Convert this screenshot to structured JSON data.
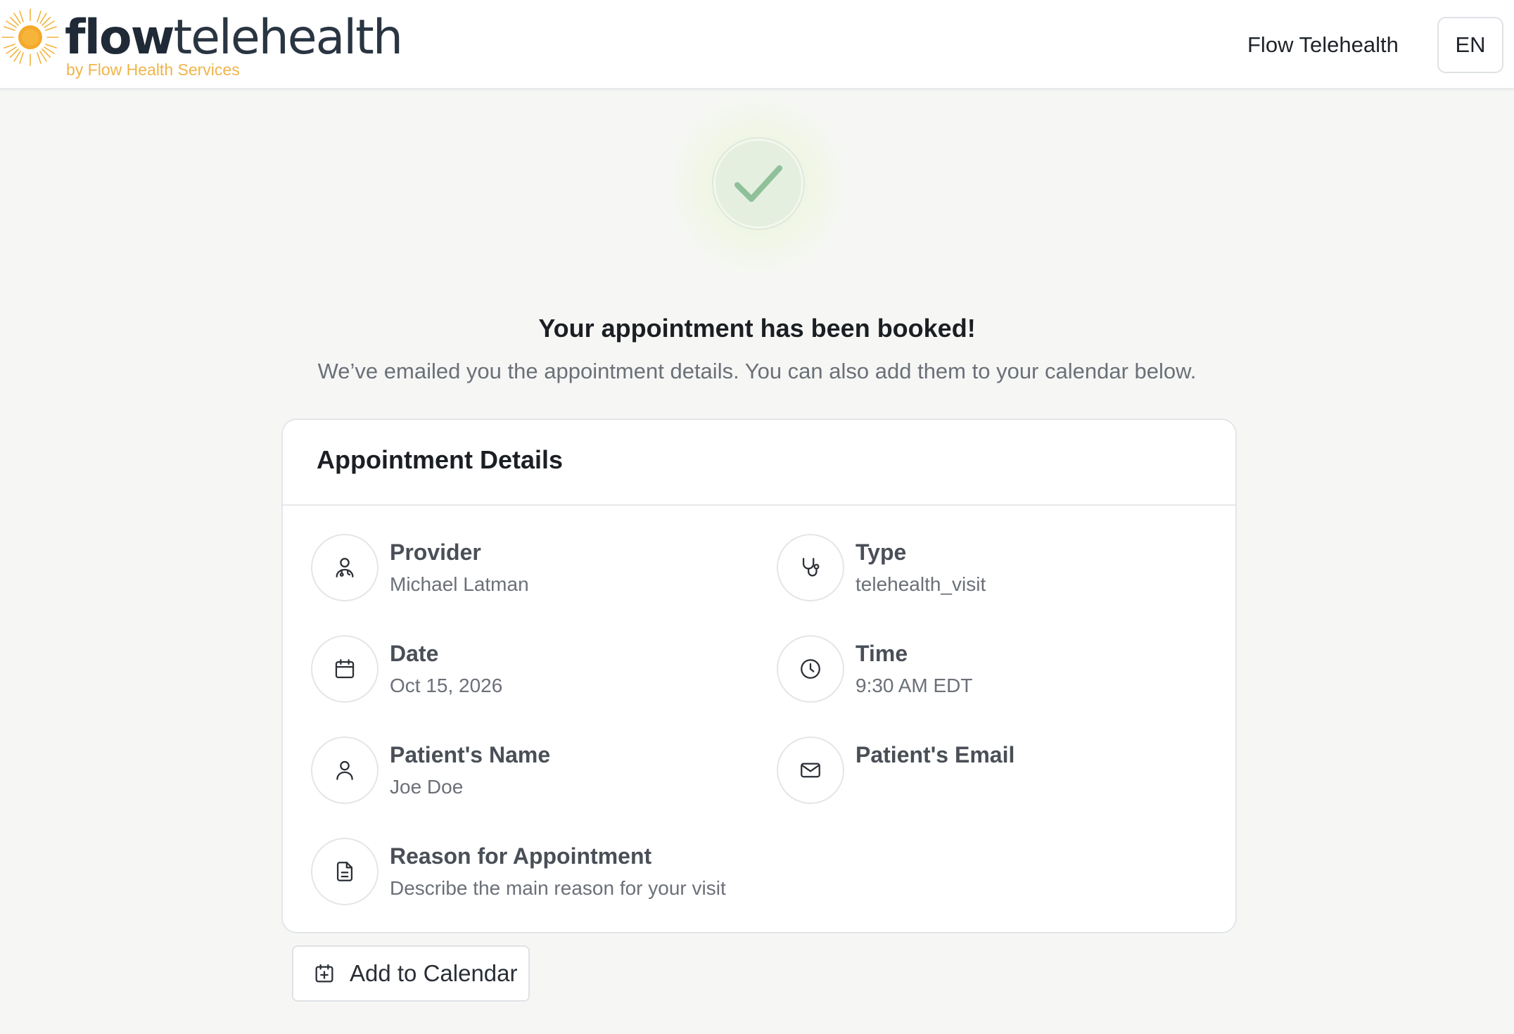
{
  "header": {
    "brand_bold": "flow",
    "brand_light": "telehealth",
    "brand_sub": "by Flow Health Services",
    "nav_link": "Flow Telehealth",
    "language": "EN"
  },
  "confirmation": {
    "title": "Your appointment has been booked!",
    "subtitle": "We’ve emailed you the appointment details. You can also add them to your calendar below."
  },
  "details": {
    "title": "Appointment Details",
    "provider": {
      "label": "Provider",
      "value": "Michael Latman",
      "icon": "doctor-icon"
    },
    "type": {
      "label": "Type",
      "value": "telehealth_visit",
      "icon": "stethoscope-icon"
    },
    "date": {
      "label": "Date",
      "value": "Oct 15, 2026",
      "icon": "calendar-icon"
    },
    "time": {
      "label": "Time",
      "value": "9:30 AM EDT",
      "icon": "clock-icon"
    },
    "patient_name": {
      "label": "Patient's Name",
      "value": "Joe Doe",
      "icon": "user-icon"
    },
    "patient_email": {
      "label": "Patient's Email",
      "value": "",
      "icon": "mail-icon"
    },
    "reason": {
      "label": "Reason for Appointment",
      "value": "Describe the main reason for your visit",
      "icon": "document-icon"
    }
  },
  "actions": {
    "add_to_calendar": "Add to Calendar"
  },
  "colors": {
    "brand_text": "#1f2a36",
    "brand_accent": "#f0b449",
    "success": "#7fb48a"
  }
}
